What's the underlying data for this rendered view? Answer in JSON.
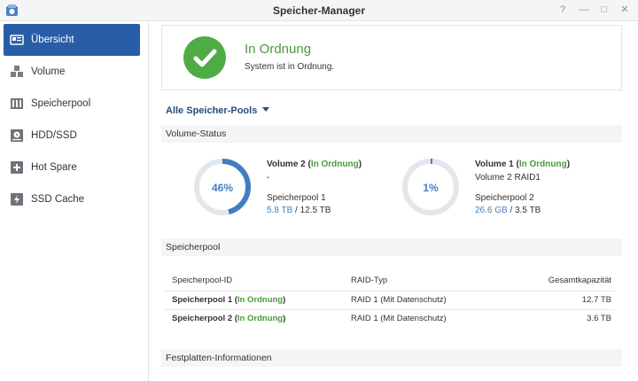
{
  "window": {
    "title": "Speicher-Manager",
    "help_glyph": "?",
    "minimize_glyph": "—",
    "maximize_glyph": "□",
    "close_glyph": "✕"
  },
  "sidebar": {
    "items": [
      {
        "label": "Übersicht",
        "icon": "overview-icon",
        "active": true
      },
      {
        "label": "Volume",
        "icon": "volume-cubes-icon",
        "active": false
      },
      {
        "label": "Speicherpool",
        "icon": "storage-pool-icon",
        "active": false
      },
      {
        "label": "HDD/SSD",
        "icon": "hdd-icon",
        "active": false
      },
      {
        "label": "Hot Spare",
        "icon": "hot-spare-icon",
        "active": false
      },
      {
        "label": "SSD Cache",
        "icon": "ssd-cache-icon",
        "active": false
      }
    ]
  },
  "status": {
    "title": "In Ordnung",
    "subtitle": "System ist in Ordnung.",
    "icon": "check-icon"
  },
  "pools_filter": {
    "label": "Alle Speicher-Pools"
  },
  "volume_status": {
    "heading": "Volume-Status",
    "volumes": [
      {
        "name": "Volume 2",
        "status_open": " (",
        "status": "In Ordnung",
        "status_close": ")",
        "description": "-",
        "pool": "Speicherpool 1",
        "used": "5.8 TB",
        "separator": " / ",
        "total": "12.5 TB",
        "percent_label": "46%",
        "percent": 0.46
      },
      {
        "name": "Volume 1",
        "status_open": " (",
        "status": "In Ordnung",
        "status_close": ")",
        "description": "Volume 2 RAID1",
        "pool": "Speicherpool 2",
        "used": "26.6 GB",
        "separator": " / ",
        "total": "3.5 TB",
        "percent_label": "1%",
        "percent": 0.01
      }
    ]
  },
  "storage_pool": {
    "heading": "Speicherpool",
    "columns": [
      "Speicherpool-ID",
      "RAID-Typ",
      "Gesamtkapazität"
    ],
    "rows": [
      {
        "id": "Speicherpool 1",
        "status_open": " (",
        "status": "In Ordnung",
        "status_close": ")",
        "raid": "RAID 1 (Mit Datenschutz)",
        "capacity": "12.7 TB"
      },
      {
        "id": "Speicherpool 2",
        "status_open": " (",
        "status": "In Ordnung",
        "status_close": ")",
        "raid": "RAID 1 (Mit Datenschutz)",
        "capacity": "3.6 TB"
      }
    ]
  },
  "disk_info": {
    "heading": "Festplatten-Informationen"
  },
  "colors": {
    "accent": "#2a5da7",
    "ok_green": "#4a9a3d",
    "usage_blue": "#3f7fc0",
    "ring_track": "#e3e6ea"
  }
}
